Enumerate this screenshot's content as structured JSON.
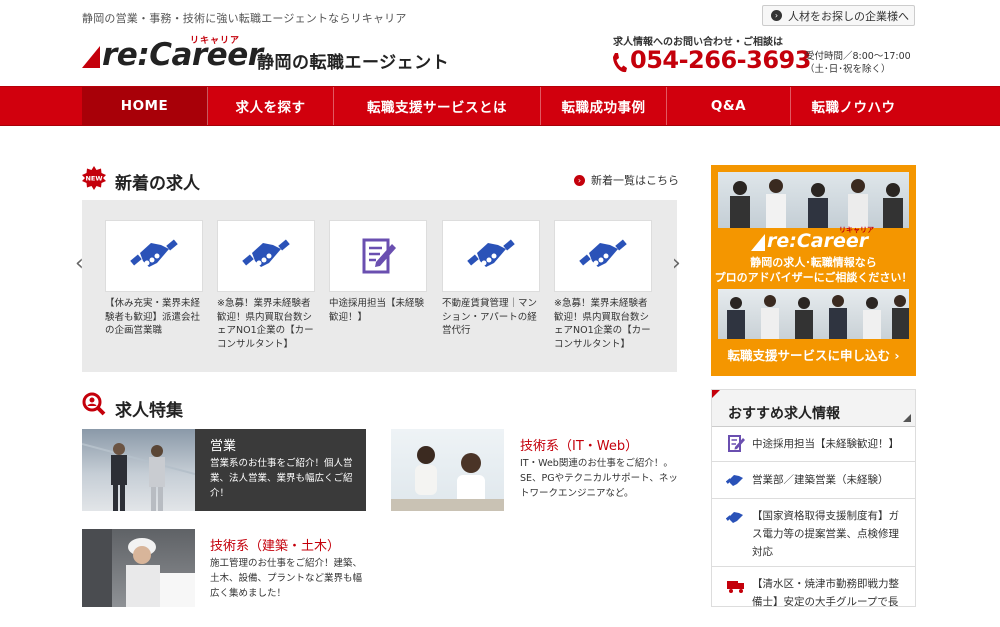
{
  "header": {
    "tagline": "静岡の営業・事務・技術に強い転職エージェントならリキャリア",
    "corp_button": "人材をお探しの企業様へ",
    "logo_text": "re:Career",
    "logo_ruby": "リキャリア",
    "logo_subtitle": "静岡の転職エージェント",
    "contact_label": "求人情報へのお問い合わせ・ご相談は",
    "phone": "054-266-3693",
    "hours_line1": "受付時間／8:00〜17:00",
    "hours_line2": "（土･日･祝を除く）"
  },
  "nav": {
    "items": [
      {
        "label": "HOME"
      },
      {
        "label": "求人を探す"
      },
      {
        "label": "転職支援サービスとは"
      },
      {
        "label": "転職成功事例"
      },
      {
        "label": "Q&A"
      },
      {
        "label": "転職ノウハウ"
      }
    ]
  },
  "new_jobs": {
    "title": "新着の求人",
    "more_link": "新着一覧はこちら",
    "new_badge": "NEW",
    "cards": [
      {
        "icon": "handshake-icon",
        "text": "【休み充実・業界未経験者も歓迎】派遣会社の企画営業職"
      },
      {
        "icon": "handshake-icon",
        "text": "※急募！業界未経験者歓迎！県内買取台数シェアNO1企業の【カーコンサルタント】"
      },
      {
        "icon": "document-pen-icon",
        "text": "中途採用担当【未経験歓迎！】"
      },
      {
        "icon": "handshake-icon",
        "text": "不動産賃貸管理｜マンション・アパートの経営代行"
      },
      {
        "icon": "handshake-icon",
        "text": "※急募！業界未経験者歓迎！県内買取台数シェアNO1企業の【カーコンサルタント】"
      }
    ]
  },
  "features": {
    "title": "求人特集",
    "items": [
      {
        "title": "営業",
        "desc": "営業系のお仕事をご紹介！個人営業、法人営業、業界も幅広くご紹介！"
      },
      {
        "title": "技術系（IT・Web）",
        "desc": "IT・Web関連のお仕事をご紹介！。SE、PGやテクニカルサポート、ネットワークエンジニアなど。"
      },
      {
        "title": "技術系（建築・土木）",
        "desc": "施工管理のお仕事をご紹介！建築、土木、設備、プラントなど業界も幅広く集めました！"
      }
    ]
  },
  "ad": {
    "logo": "re:Career",
    "ruby": "リキャリア",
    "line1": "静岡の求人･転職情報なら",
    "line2": "プロのアドバイザーにご相談ください！",
    "cta": "転職支援サービスに申し込む"
  },
  "recommend": {
    "title": "おすすめ求人情報",
    "items": [
      {
        "icon": "document-pen-icon",
        "text": "中途採用担当【未経験歓迎！】"
      },
      {
        "icon": "handshake-icon",
        "text": "営業部／建築営業（未経験）"
      },
      {
        "icon": "handshake-icon",
        "text": "【国家資格取得支援制度有】ガス電力等の提案営業、点検修理対応"
      },
      {
        "icon": "truck-icon",
        "text": "【清水区・焼津市勤務即戦力整備士】安定の大手グループで長"
      }
    ]
  },
  "colors": {
    "brand_red": "#d1000d",
    "icon_blue": "#2a52b8",
    "ad_orange": "#f49600"
  }
}
